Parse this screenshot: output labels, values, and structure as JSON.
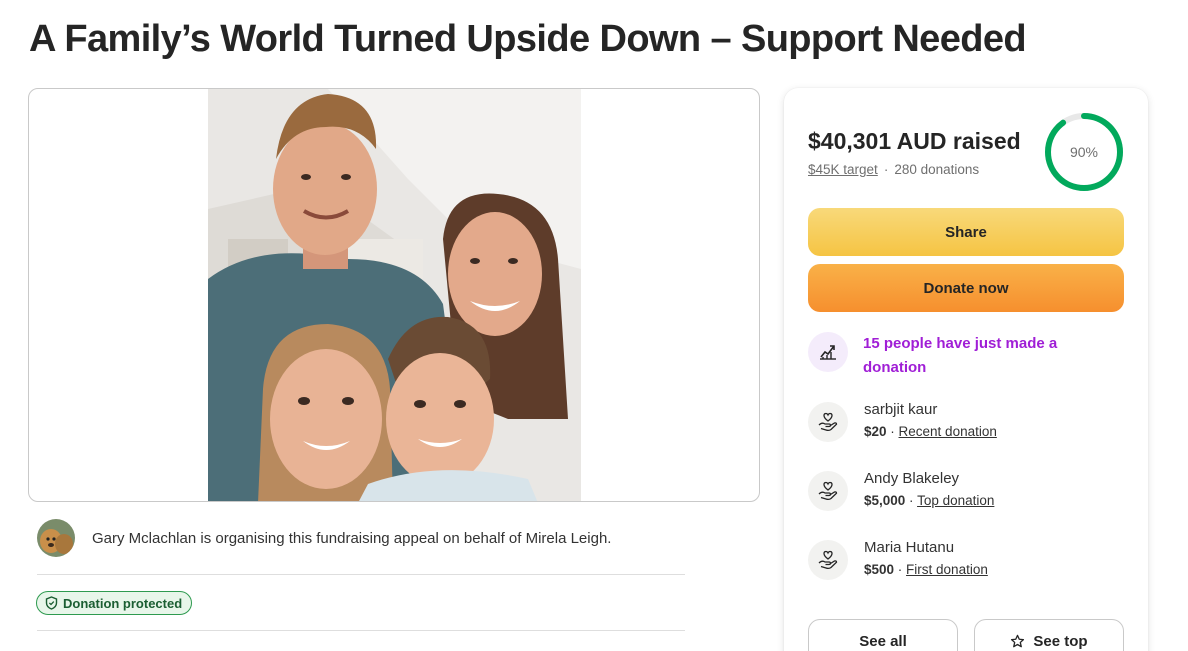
{
  "page": {
    "title": "A Family’s World Turned Upside Down – Support Needed"
  },
  "organiser": {
    "text": "Gary Mclachlan is organising this fundraising appeal on behalf of Mirela Leigh."
  },
  "badge": {
    "label": "Donation protected"
  },
  "donation_card": {
    "raised": "$40,301 AUD raised",
    "target": "$45K target",
    "separator": "·",
    "donations_count": "280 donations",
    "progress_percent": 90,
    "progress_label": "90%",
    "share_label": "Share",
    "donate_label": "Donate now",
    "trend_text": "15 people have just made a donation",
    "donors": [
      {
        "name": "sarbjit kaur",
        "amount": "$20",
        "sep": " · ",
        "type": "Recent donation"
      },
      {
        "name": "Andy Blakeley",
        "amount": "$5,000",
        "sep": " · ",
        "type": "Top donation"
      },
      {
        "name": "Maria Hutanu",
        "amount": "$500",
        "sep": " · ",
        "type": "First donation"
      }
    ],
    "see_all_label": "See all",
    "see_top_label": "See top"
  },
  "colors": {
    "progress": "#02a95c",
    "share_button": "#f5c443",
    "donate_button": "#f68f2e",
    "trend_text": "#a01ed6",
    "badge_border": "#2e9a4f"
  },
  "icons": {
    "trend": "trending-up-icon",
    "donor": "heart-hand-icon",
    "shield": "shield-icon",
    "star": "star-icon"
  }
}
